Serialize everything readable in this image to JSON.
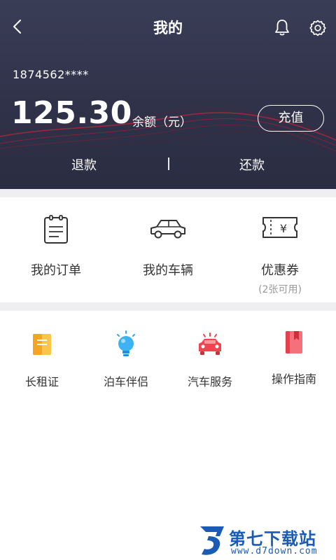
{
  "header": {
    "title": "我的",
    "phone": "1874562****",
    "balance": "125.30",
    "balance_label": "余额（元）",
    "recharge_label": "充值",
    "refund_label": "退款",
    "repay_label": "还款"
  },
  "quick_menu": {
    "items": [
      {
        "label": "我的订单",
        "icon": "clipboard-icon"
      },
      {
        "label": "我的车辆",
        "icon": "car-outline-icon"
      },
      {
        "label": "优惠券",
        "sub": "(2张可用)",
        "icon": "coupon-icon"
      }
    ]
  },
  "services": {
    "items": [
      {
        "label": "长租证",
        "icon": "permit-icon",
        "color": "#f7b731"
      },
      {
        "label": "泊车伴侣",
        "icon": "lightbulb-icon",
        "color": "#2fa8f0"
      },
      {
        "label": "汽车服务",
        "icon": "car-service-icon",
        "color": "#f1444e"
      },
      {
        "label": "操作指南",
        "icon": "guide-book-icon",
        "color": "#e8404a"
      }
    ]
  },
  "watermark": {
    "name": "第七下载站",
    "url": "www.d7down.com"
  },
  "colors": {
    "header_bg": "#2f3249",
    "accent_red": "#e63a46",
    "gap_gray": "#efeff1"
  }
}
